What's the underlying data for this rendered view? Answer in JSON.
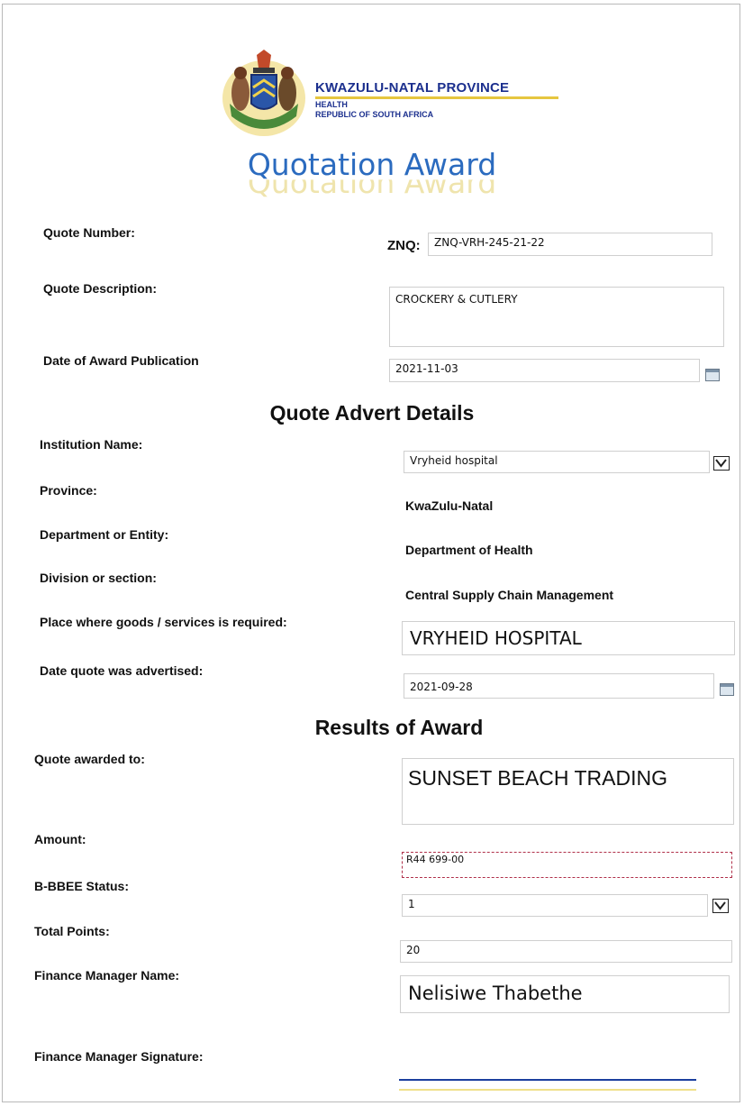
{
  "header": {
    "province": "KWAZULU-NATAL PROVINCE",
    "health": "HEALTH",
    "republic": "REPUBLIC OF SOUTH AFRICA",
    "title": "Quotation Award",
    "crest_icon": "coat-of-arms-icon"
  },
  "quote": {
    "number_label": "Quote Number:",
    "number_prefix": "ZNQ:",
    "number_value": "ZNQ-VRH-245-21-22",
    "description_label": "Quote Description:",
    "description_value": "CROCKERY & CUTLERY",
    "award_date_label": "Date of Award Publication",
    "award_date_value": "2021-11-03"
  },
  "advert": {
    "heading": "Quote Advert Details",
    "institution_label": "Institution Name:",
    "institution_value": "Vryheid hospital",
    "province_label": "Province:",
    "province_value": "KwaZulu-Natal",
    "department_label": "Department or Entity:",
    "department_value": "Department of Health",
    "division_label": "Division or section:",
    "division_value": "Central Supply Chain Management",
    "place_label": "Place where goods /  services is required:",
    "place_value": "VRYHEID HOSPITAL",
    "advertised_label": "Date quote was advertised:",
    "advertised_value": "2021-09-28"
  },
  "results": {
    "heading": "Results of Award",
    "awarded_label": "Quote awarded to:",
    "awarded_value": "SUNSET BEACH TRADING",
    "amount_label": "Amount:",
    "amount_value": "R44 699-00",
    "bbbee_label": "B-BBEE Status:",
    "bbbee_value": "1",
    "points_label": "Total Points:",
    "points_value": "20",
    "fm_name_label": "Finance Manager Name:",
    "fm_name_value": "Nelisiwe Thabethe",
    "fm_signature_label": "Finance Manager Signature:"
  },
  "colors": {
    "title_blue": "#2b6bbf",
    "province_blue": "#1b2f8e",
    "amount_border": "#b0304a"
  }
}
